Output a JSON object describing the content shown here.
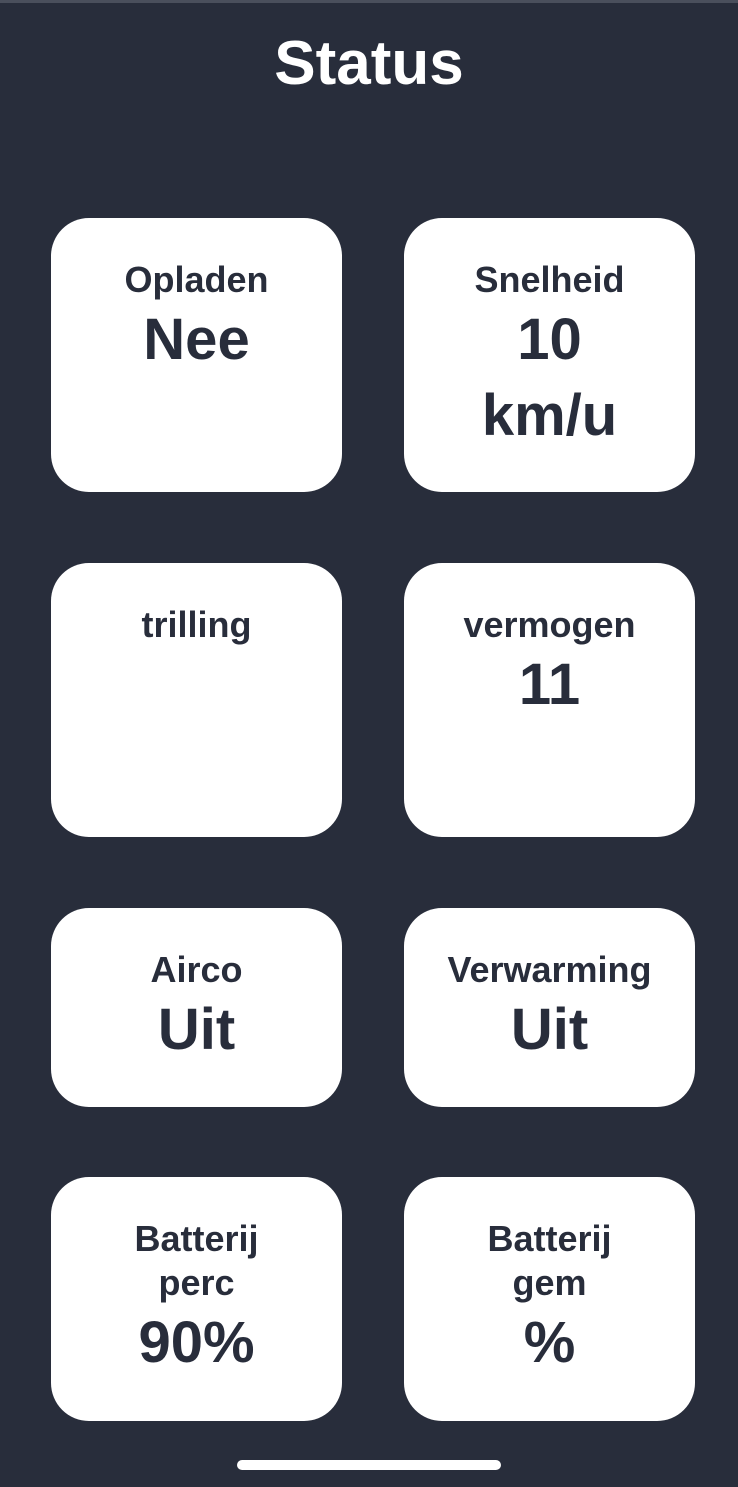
{
  "header": {
    "title": "Status"
  },
  "cards": {
    "opladen": {
      "label": "Opladen",
      "value": "Nee"
    },
    "snelheid": {
      "label": "Snelheid",
      "value_line1": "10",
      "value_line2": "km/u"
    },
    "trilling": {
      "label": "trilling",
      "value": ""
    },
    "vermogen": {
      "label": "vermogen",
      "value": "11"
    },
    "airco": {
      "label": "Airco",
      "value": "Uit"
    },
    "verwarming": {
      "label": "Verwarming",
      "value": "Uit"
    },
    "batterij_perc": {
      "label_line1": "Batterij",
      "label_line2": "perc",
      "value": "90%"
    },
    "batterij_gem": {
      "label_line1": "Batterij",
      "label_line2": "gem",
      "value": "%"
    }
  },
  "colors": {
    "background": "#282d3b",
    "card": "#ffffff",
    "text_dark": "#282d3b",
    "text_light": "#ffffff"
  }
}
